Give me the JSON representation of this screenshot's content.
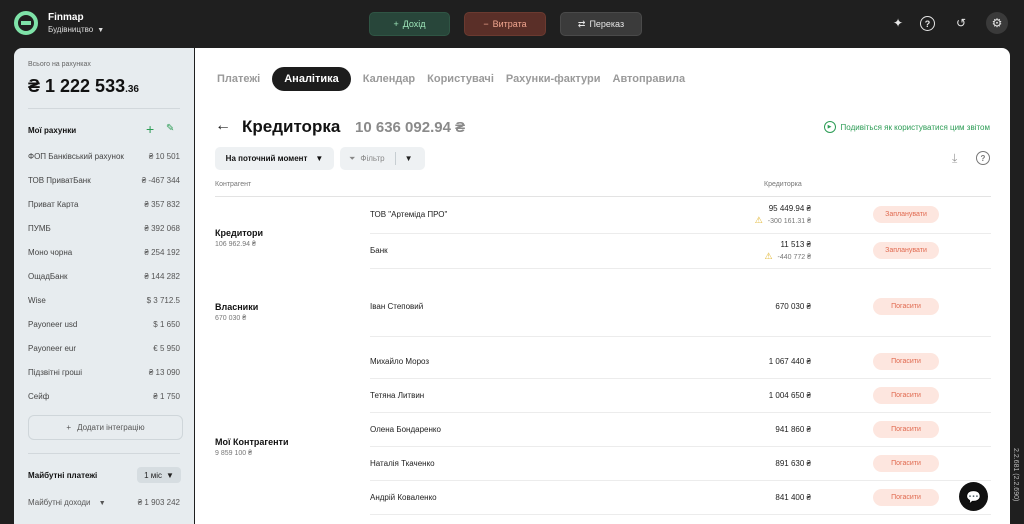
{
  "header": {
    "brand": "Finmap",
    "company": "Будівництво",
    "btn_income": "Дохід",
    "btn_expense": "Витрата",
    "btn_transfer": "Переказ",
    "icons": [
      "sparkle-icon",
      "help-icon",
      "history-icon",
      "settings-icon"
    ]
  },
  "sidebar": {
    "total_label": "Всього на рахунках",
    "total_main": "₴ 1 222 533",
    "total_cents": ".36",
    "accounts_title": "Мої рахунки",
    "accounts": [
      {
        "name": "ФОП Банківський рахунок",
        "amount": "₴ 10 501"
      },
      {
        "name": "ТОВ ПриватБанк",
        "amount": "₴ -467 344"
      },
      {
        "name": "Приват Карта",
        "amount": "₴ 357 832"
      },
      {
        "name": "ПУМБ",
        "amount": "₴ 392 068"
      },
      {
        "name": "Моно чорна",
        "amount": "₴ 254 192"
      },
      {
        "name": "ОщадБанк",
        "amount": "₴ 144 282"
      },
      {
        "name": "Wise",
        "amount": "$ 3 712.5"
      },
      {
        "name": "Payoneer usd",
        "amount": "$ 1 650"
      },
      {
        "name": "Payoneer eur",
        "amount": "€ 5 950"
      },
      {
        "name": "Підзвітні гроші",
        "amount": "₴ 13 090"
      },
      {
        "name": "Сейф",
        "amount": "₴ 1 750"
      }
    ],
    "add_integration": "Додати інтеграцію",
    "future_title": "Майбутні платежі",
    "period": "1 міс",
    "future_income_label": "Майбутні доходи",
    "future_income_amount": "₴ 1 903 242"
  },
  "tabs": [
    "Платежі",
    "Аналітика",
    "Календар",
    "Користувачі",
    "Рахунки-фактури",
    "Автоправила"
  ],
  "page": {
    "title": "Кредиторка",
    "total": "10 636 092.94 ₴",
    "howto": "Подивіться як користуватися цим звітом",
    "moment": "На поточний момент",
    "filter": "Фільтр",
    "col_counterparty": "Контрагент",
    "col_creditor": "Кредиторка"
  },
  "groups": [
    {
      "name": "Кредитори",
      "total": "106 962.94 ₴"
    },
    {
      "name": "Власники",
      "total": "670 030 ₴"
    },
    {
      "name": "Мої Контрагенти",
      "total": "9 859 100 ₴"
    }
  ],
  "rows": [
    {
      "name": "ТОВ \"Артеміда ПРО\"",
      "amount": "95 449.94 ₴",
      "sub": "-300 161.31 ₴",
      "action": "Запланувати"
    },
    {
      "name": "Банк",
      "amount": "11 513 ₴",
      "sub": "-440 772 ₴",
      "action": "Запланувати"
    },
    {
      "name": "Іван Степовий",
      "amount": "670 030 ₴",
      "action": "Погасити"
    },
    {
      "name": "Михайло Мороз",
      "amount": "1 067 440 ₴",
      "action": "Погасити"
    },
    {
      "name": "Тетяна Литвин",
      "amount": "1 004 650 ₴",
      "action": "Погасити"
    },
    {
      "name": "Олена Бондаренко",
      "amount": "941 860 ₴",
      "action": "Погасити"
    },
    {
      "name": "Наталія Ткаченко",
      "amount": "891 630 ₴",
      "action": "Погасити"
    },
    {
      "name": "Андрій Коваленко",
      "amount": "841 400 ₴",
      "action": "Погасити"
    }
  ],
  "version": "2.2.681 (2.2.690)",
  "colors": {
    "accent": "#2c9c55",
    "pill_bg": "#fde6df",
    "pill_text": "#e0694f"
  }
}
